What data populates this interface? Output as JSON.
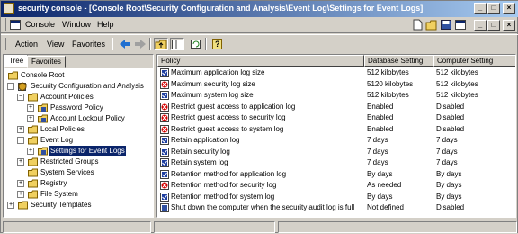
{
  "window": {
    "title": "security console - [Console Root\\Security Configuration and Analysis\\Event Log\\Settings for Event Logs]",
    "caption_buttons": [
      "_",
      "□",
      "×"
    ]
  },
  "menubar": {
    "items": [
      "Console",
      "Window",
      "Help"
    ],
    "mdi_buttons": [
      "_",
      "□",
      "×"
    ]
  },
  "actionbar": {
    "items": [
      "Action",
      "View",
      "Favorites"
    ],
    "icons": [
      "back-icon",
      "forward-icon",
      "up-folder-icon",
      "show-tree-icon",
      "refresh-icon",
      "help-icon"
    ]
  },
  "left": {
    "tabs": [
      "Tree",
      "Favorites"
    ],
    "tree": [
      {
        "label": "Console Root",
        "level": 0,
        "expander": "",
        "icon": "folder"
      },
      {
        "label": "Security Configuration and Analysis",
        "level": 1,
        "expander": "-",
        "icon": "shield"
      },
      {
        "label": "Account Policies",
        "level": 2,
        "expander": "-",
        "icon": "folder"
      },
      {
        "label": "Password Policy",
        "level": 3,
        "expander": "+",
        "icon": "policy"
      },
      {
        "label": "Account Lockout Policy",
        "level": 3,
        "expander": "+",
        "icon": "policy"
      },
      {
        "label": "Local Policies",
        "level": 2,
        "expander": "+",
        "icon": "folder"
      },
      {
        "label": "Event Log",
        "level": 2,
        "expander": "-",
        "icon": "folder"
      },
      {
        "label": "Settings for Event Logs",
        "level": 3,
        "expander": "+",
        "icon": "policy",
        "selected": true
      },
      {
        "label": "Restricted Groups",
        "level": 2,
        "expander": "+",
        "icon": "folder"
      },
      {
        "label": "System Services",
        "level": 2,
        "expander": "",
        "icon": "folder"
      },
      {
        "label": "Registry",
        "level": 2,
        "expander": "+",
        "icon": "folder"
      },
      {
        "label": "File System",
        "level": 2,
        "expander": "+",
        "icon": "folder"
      },
      {
        "label": "Security Templates",
        "level": 1,
        "expander": "+",
        "icon": "folder"
      }
    ]
  },
  "table": {
    "columns": [
      "Policy",
      "Database Setting",
      "Computer Setting"
    ],
    "rows": [
      {
        "policy": "Maximum application log size",
        "db": "512 kilobytes",
        "comp": "512 kilobytes",
        "mark": "ok"
      },
      {
        "policy": "Maximum security log size",
        "db": "5120 kilobytes",
        "comp": "512 kilobytes",
        "mark": "bad"
      },
      {
        "policy": "Maximum system log size",
        "db": "512 kilobytes",
        "comp": "512 kilobytes",
        "mark": "ok"
      },
      {
        "policy": "Restrict guest access to application log",
        "db": "Enabled",
        "comp": "Disabled",
        "mark": "bad"
      },
      {
        "policy": "Restrict guest access to security log",
        "db": "Enabled",
        "comp": "Disabled",
        "mark": "bad"
      },
      {
        "policy": "Restrict guest access to system log",
        "db": "Enabled",
        "comp": "Disabled",
        "mark": "bad"
      },
      {
        "policy": "Retain application log",
        "db": "7 days",
        "comp": "7 days",
        "mark": "ok"
      },
      {
        "policy": "Retain security log",
        "db": "7 days",
        "comp": "7 days",
        "mark": "ok"
      },
      {
        "policy": "Retain system log",
        "db": "7 days",
        "comp": "7 days",
        "mark": "ok"
      },
      {
        "policy": "Retention method for application log",
        "db": "By days",
        "comp": "By days",
        "mark": "ok"
      },
      {
        "policy": "Retention method for security log",
        "db": "As needed",
        "comp": "By days",
        "mark": "bad"
      },
      {
        "policy": "Retention method for system log",
        "db": "By days",
        "comp": "By days",
        "mark": "ok"
      },
      {
        "policy": "Shut down the computer when the security audit log is full",
        "db": "Not defined",
        "comp": "Disabled",
        "mark": "none"
      }
    ]
  },
  "colors": {
    "title_start": "#0a246a",
    "title_end": "#a6caf0",
    "face": "#d4d0c8",
    "bad": "#d40000",
    "ok": "#1f3fa0"
  }
}
